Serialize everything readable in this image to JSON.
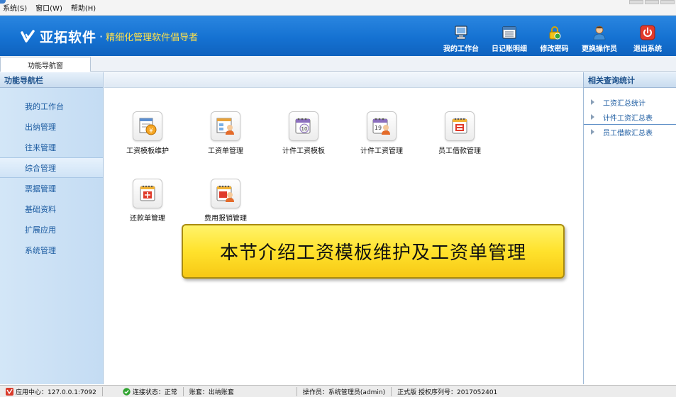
{
  "menu": {
    "items": [
      "系统(S)",
      "窗口(W)",
      "帮助(H)"
    ]
  },
  "header": {
    "brand": "亚拓软件",
    "separator": "·",
    "slogan": "精细化管理软件倡导者",
    "slogan_color": "#ffe14a",
    "toolbar": [
      {
        "label": "我的工作台",
        "icon": "monitor-icon"
      },
      {
        "label": "日记账明细",
        "icon": "ledger-icon"
      },
      {
        "label": "修改密码",
        "icon": "lock-icon"
      },
      {
        "label": "更换操作员",
        "icon": "user-icon"
      },
      {
        "label": "退出系统",
        "icon": "power-icon"
      }
    ]
  },
  "tabs": [
    {
      "label": "功能导航窗"
    }
  ],
  "left_nav": {
    "title": "功能导航栏",
    "items": [
      "我的工作台",
      "出纳管理",
      "往来管理",
      "综合管理",
      "票据管理",
      "基础资料",
      "扩展应用",
      "系统管理"
    ],
    "active": "综合管理"
  },
  "functions": [
    {
      "label": "工资模板维护",
      "icon": "salary-template-icon"
    },
    {
      "label": "工资单管理",
      "icon": "payslip-icon"
    },
    {
      "label": "计件工资模板",
      "icon": "piece-rate-template-icon"
    },
    {
      "label": "计件工资管理",
      "icon": "piece-rate-manage-icon"
    },
    {
      "label": "员工借款管理",
      "icon": "loan-icon"
    },
    {
      "label": "还款单管理",
      "icon": "repayment-icon"
    },
    {
      "label": "费用报销管理",
      "icon": "reimbursement-icon"
    }
  ],
  "banner": {
    "text": "本节介绍工资模板维护及工资单管理"
  },
  "right_panel": {
    "title": "相关查询统计",
    "items": [
      "工资汇总统计",
      "计件工资汇总表",
      "员工借款汇总表"
    ]
  },
  "status": {
    "app_center": "应用中心：127.0.0.1:7092",
    "connection": "连接状态：正常",
    "account": "账套：出纳账套",
    "operator": "操作员：系统管理员(admin)",
    "license": "正式版 授权序列号：2017052401"
  },
  "colors": {
    "header_blue": "#1572d2",
    "nav_text": "#1a5aa0",
    "banner_yellow": "#ffe22c"
  }
}
